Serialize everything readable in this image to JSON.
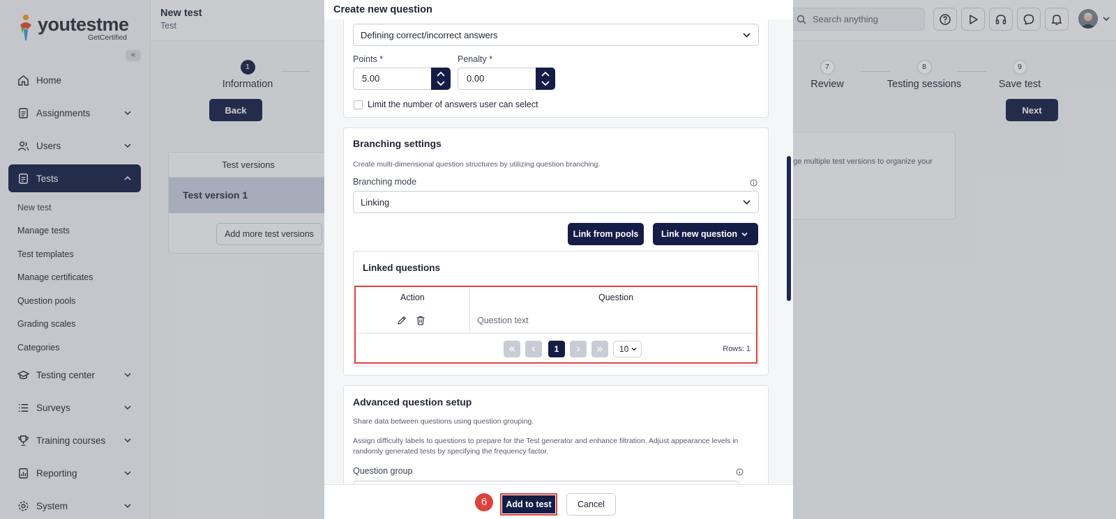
{
  "sidebar": {
    "logo_text_you": "you",
    "logo_text_test": "test",
    "logo_text_me": "me",
    "logo_sub": "GetCertified",
    "collapse_glyph": "«",
    "items": [
      {
        "label": "Home",
        "icon": "home-icon"
      },
      {
        "label": "Assignments",
        "icon": "assignments-icon"
      },
      {
        "label": "Users",
        "icon": "users-icon"
      },
      {
        "label": "Tests",
        "icon": "tests-icon",
        "active": true
      },
      {
        "label": "Testing center",
        "icon": "testing-center-icon"
      },
      {
        "label": "Surveys",
        "icon": "surveys-icon"
      },
      {
        "label": "Training courses",
        "icon": "trophy-icon"
      },
      {
        "label": "Reporting",
        "icon": "reporting-icon"
      },
      {
        "label": "System",
        "icon": "gear-icon"
      }
    ],
    "tests_submenu": [
      "New test",
      "Manage tests",
      "Test templates",
      "Manage certificates",
      "Question pools",
      "Grading scales",
      "Categories"
    ]
  },
  "topbar": {
    "title": "New test",
    "subtitle": "Test",
    "search_placeholder": "Search anything"
  },
  "wizard": {
    "steps": [
      {
        "num": "1",
        "label": "Information"
      },
      {
        "num": "7",
        "label": "Review"
      },
      {
        "num": "8",
        "label": "Testing sessions"
      },
      {
        "num": "9",
        "label": "Save test"
      }
    ],
    "back_label": "Back",
    "next_label": "Next"
  },
  "versions": {
    "header": "Test versions",
    "row": "Test version 1",
    "add_label": "Add more test versions",
    "info_text": "age multiple test versions to organize your"
  },
  "modal": {
    "title": "Create new question",
    "answer_mode": "Defining correct/incorrect answers",
    "points_label": "Points",
    "points_value": "5.00",
    "penalty_label": "Penalty",
    "penalty_value": "0.00",
    "required_mark": "*",
    "limit_label": "Limit the number of answers user can select",
    "branching": {
      "title": "Branching settings",
      "hint": "Create multi-dimensional question structures by utilizing question branching.",
      "mode_label": "Branching mode",
      "mode_value": "Linking",
      "link_pools_label": "Link from pools",
      "link_new_label": "Link new question",
      "linked_title": "Linked questions",
      "col_action": "Action",
      "col_question": "Question",
      "question_text": "Question text",
      "page_current": "1",
      "rows_per_page": "10",
      "rows_count": "Rows: 1"
    },
    "advanced": {
      "title": "Advanced question setup",
      "hint1": "Share data between questions using question grouping.",
      "hint2": "Assign difficulty labels to questions to prepare for the Test generator and enhance filtration. Adjust appearance levels in randomly generated tests by specifying the frequency factor.",
      "group_label": "Question group"
    },
    "step_badge": "6",
    "add_label": "Add to test",
    "cancel_label": "Cancel"
  },
  "colors": {
    "primary": "#141d46",
    "highlight": "#e0413a"
  }
}
